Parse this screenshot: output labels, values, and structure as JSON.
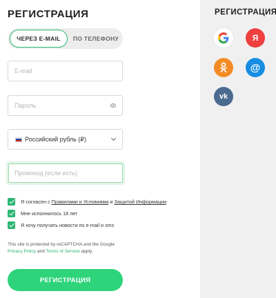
{
  "form": {
    "title": "РЕГИСТРАЦИЯ",
    "tabs": [
      {
        "label": "ЧЕРЕЗ E-MAIL",
        "active": true
      },
      {
        "label": "ПО ТЕЛЕФОНУ",
        "active": false
      }
    ],
    "email": {
      "placeholder": "E-mail",
      "value": ""
    },
    "password": {
      "placeholder": "Пароль",
      "value": ""
    },
    "currency": {
      "selected": "Российский рубль (₽)"
    },
    "promo": {
      "placeholder": "Промокод (если есть)",
      "value": ""
    },
    "checkboxes": [
      {
        "prefix": "Я согласен с ",
        "link1": "Правилами и Условиями",
        "middle": " и ",
        "link2": "Защитой Информации",
        "checked": true
      },
      {
        "text": "Мне исполнилось 18 лет",
        "checked": true
      },
      {
        "text": "Я хочу получать новости по e-mail и sms",
        "checked": true
      }
    ],
    "recaptcha": {
      "line1": "This site is protected by reCAPTCHA and the Google",
      "privacy": "Privacy Policy",
      "and": " and ",
      "terms": "Terms of Service",
      "apply": " apply."
    },
    "submit_label": "РЕГИСТРАЦИЯ"
  },
  "social": {
    "title": "РЕГИСТРАЦИЯ",
    "providers": [
      {
        "icon": "google-icon"
      },
      {
        "icon": "yandex-icon",
        "glyph": "Я",
        "color": "#ef3f3f"
      },
      {
        "icon": "odnoklassniki-icon",
        "color": "#f28b24"
      },
      {
        "icon": "mailru-icon",
        "glyph": "@",
        "color": "#168de2"
      },
      {
        "icon": "vk-icon",
        "glyph": "vk",
        "color": "#4a6a8f"
      }
    ]
  },
  "colors": {
    "accent": "#2ed47a",
    "check": "#2bb673"
  }
}
